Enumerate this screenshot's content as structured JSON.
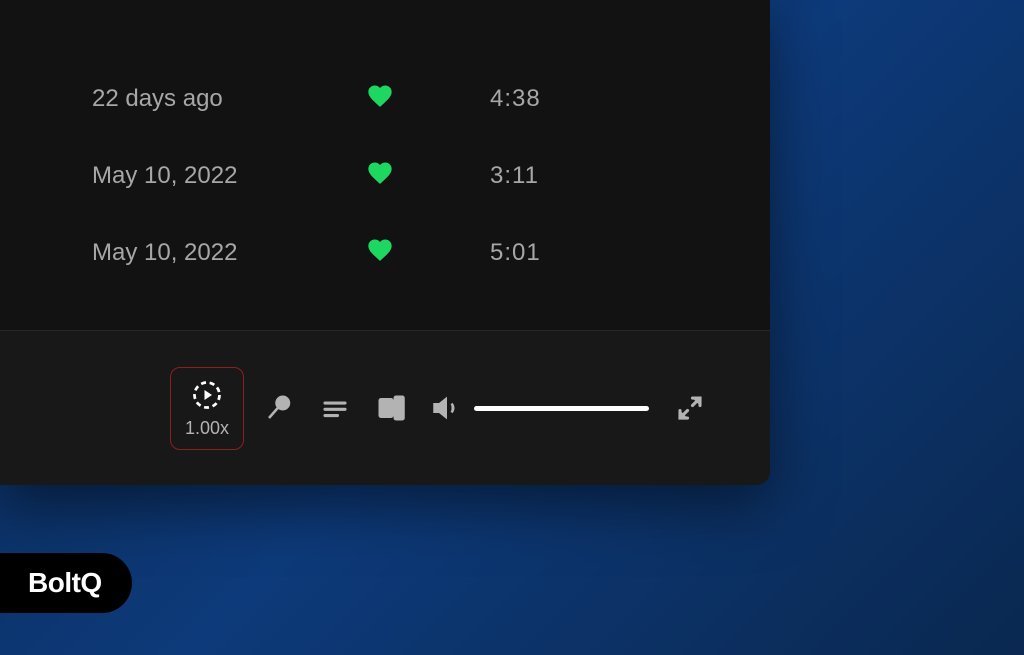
{
  "tracks": [
    {
      "date": "22 days ago",
      "liked": true,
      "duration": "4:38"
    },
    {
      "date": "May 10, 2022",
      "liked": true,
      "duration": "3:11"
    },
    {
      "date": "May 10, 2022",
      "liked": true,
      "duration": "5:01"
    }
  ],
  "player": {
    "speed_label": "1.00x"
  },
  "brand": {
    "name": "BoltQ"
  },
  "colors": {
    "accent_green": "#1ed760",
    "highlight_red": "#8b2020"
  }
}
